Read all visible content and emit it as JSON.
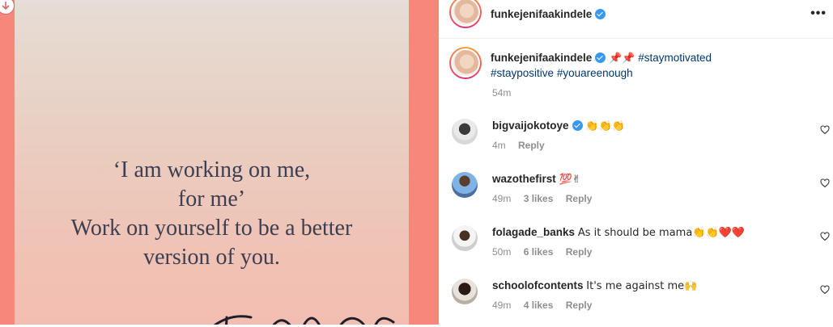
{
  "media": {
    "quote_lines": [
      "‘I am working on me,",
      "for me’",
      "Work on yourself to be a better",
      "version of you."
    ],
    "signature": "Funke Akindele"
  },
  "header": {
    "username": "funkejenifaakindele",
    "more_label": "•••"
  },
  "caption": {
    "username": "funkejenifaakindele",
    "emojis": "📌📌",
    "hashtags": [
      "#staymotivated",
      "#staypositive",
      "#youareenough"
    ],
    "time": "54m"
  },
  "comments": [
    {
      "username": "bigvaijokotoye",
      "verified": true,
      "text": "👏👏👏",
      "time": "4m",
      "likes": "",
      "reply": "Reply"
    },
    {
      "username": "wazothefirst",
      "verified": false,
      "text": "💯✌",
      "time": "49m",
      "likes": "3 likes",
      "reply": "Reply"
    },
    {
      "username": "folagade_banks",
      "verified": false,
      "text": "As it should be mama👏👏❤️❤️",
      "time": "50m",
      "likes": "6 likes",
      "reply": "Reply"
    },
    {
      "username": "schoolofcontents",
      "verified": false,
      "text": "It's me against me🙌",
      "time": "49m",
      "likes": "4 likes",
      "reply": "Reply"
    }
  ],
  "colors": {
    "media_bg": "#f6877a",
    "hashtag": "#00376b",
    "verified": "#3897f0",
    "meta": "#8e8e8e"
  }
}
